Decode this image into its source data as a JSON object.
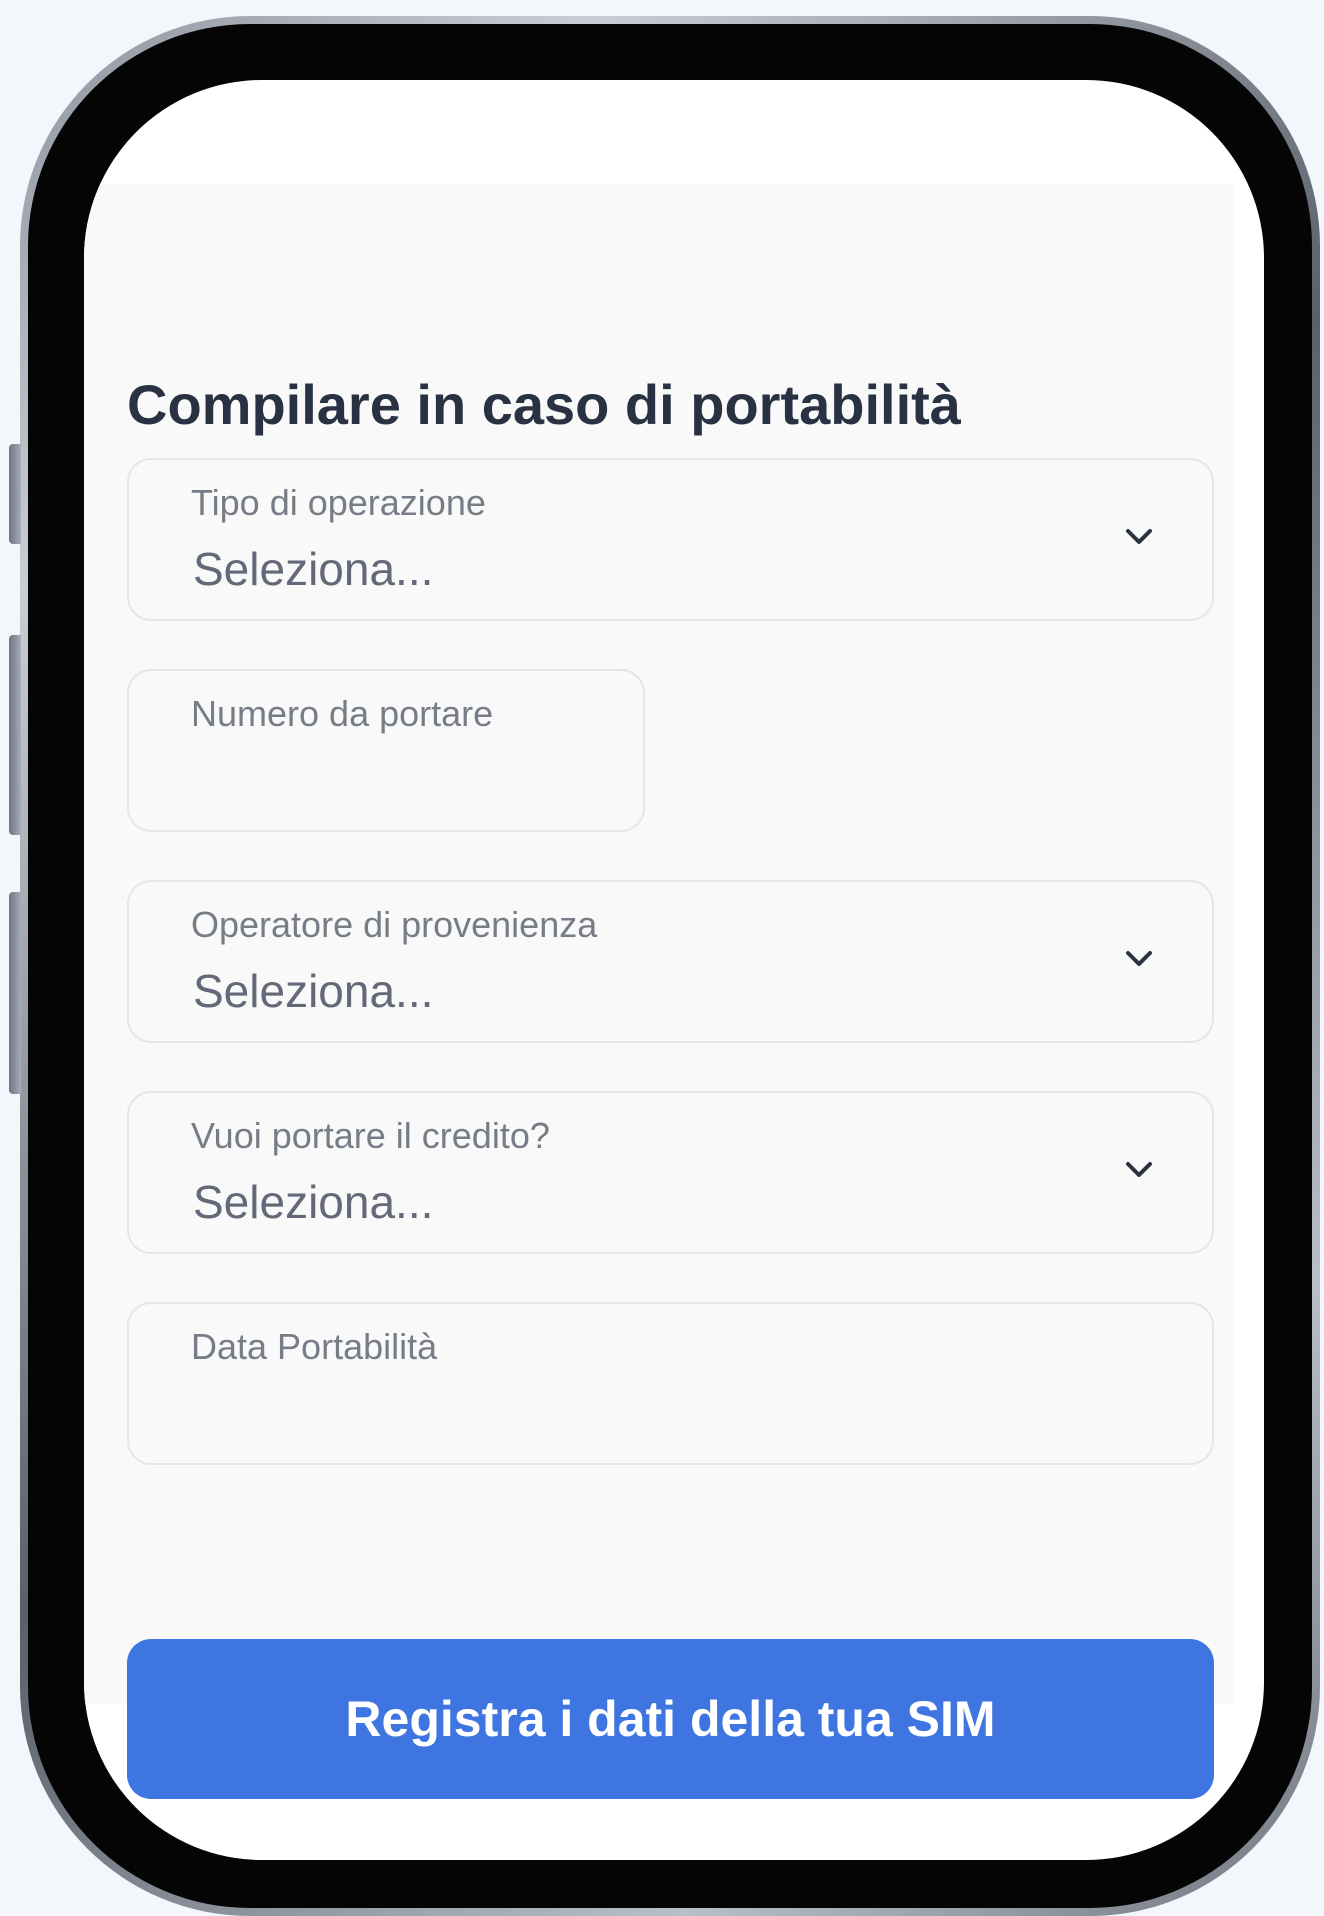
{
  "form": {
    "section_title": "Compilare in caso di portabilità",
    "fields": {
      "tipo_operazione": {
        "label": "Tipo di operazione",
        "value": "Seleziona..."
      },
      "numero": {
        "label": "Numero da portare"
      },
      "operatore": {
        "label": "Operatore di provenienza",
        "value": "Seleziona..."
      },
      "credito": {
        "label": "Vuoi portare il credito?",
        "value": "Seleziona..."
      },
      "data": {
        "label": "Data Portabilità"
      }
    },
    "submit_label": "Registra i dati della tua SIM"
  },
  "icons": {
    "dropdown": "chevron-down-icon"
  },
  "colors": {
    "accent": "#3f75e0",
    "title": "#283242",
    "label": "#777d86",
    "value": "#64697a",
    "field_background": "#f9f9f9"
  }
}
